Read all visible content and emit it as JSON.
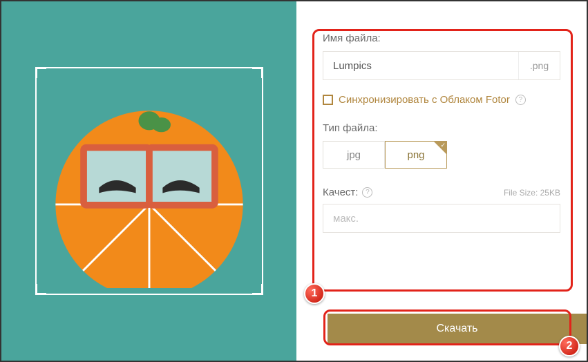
{
  "markers": {
    "one": "1",
    "two": "2"
  },
  "form": {
    "filename_label": "Имя файла:",
    "filename_value": "Lumpics",
    "filename_ext": ".png",
    "sync_label": "Синхронизировать с Облаком Fotor",
    "type_label": "Тип файла:",
    "type_jpg": "jpg",
    "type_png": "png",
    "quality_label": "Качест:",
    "quality_value": "макс.",
    "filesize": "File Size: 25KB",
    "download": "Скачать",
    "help": "?"
  }
}
